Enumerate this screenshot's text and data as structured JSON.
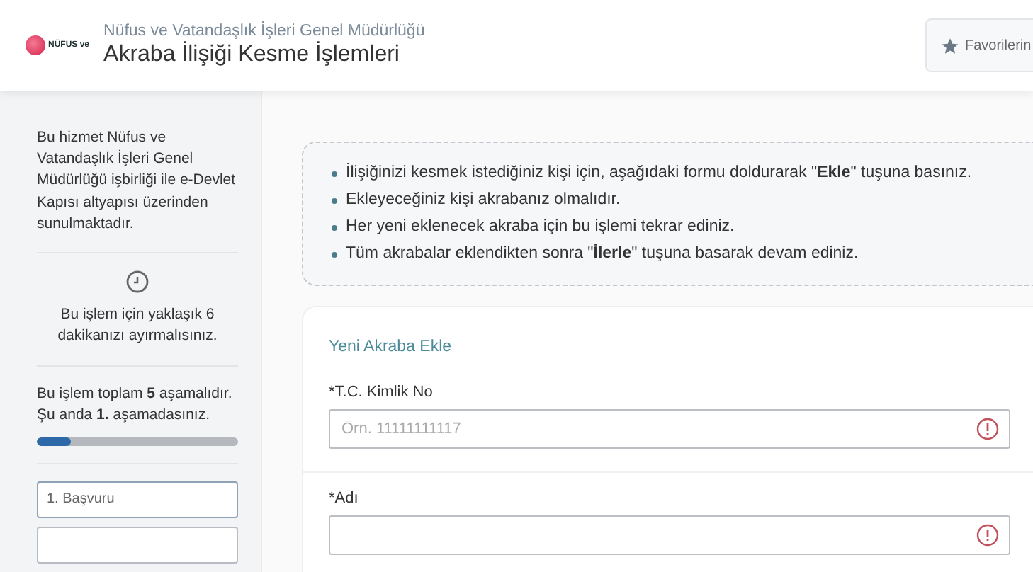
{
  "header": {
    "logo_text": "NÜFUS ve",
    "organization": "Nüfus ve Vatandaşlık İşleri Genel Müdürlüğü",
    "title": "Akraba İlişiği Kesme İşlemleri",
    "favorites_button": "Favorilerin"
  },
  "sidebar": {
    "info": "Bu hizmet Nüfus ve Vatandaşlık İşleri Genel Müdürlüğü işbirliği ile e-Devlet Kapısı altyapısı üzerinden sunulmaktadır.",
    "duration": "Bu işlem için yaklaşık 6 dakikanızı ayırmalısınız.",
    "progress": {
      "text": "Bu işlem toplam **5** aşamalıdır. Şu anda **1.** aşamadasınız.",
      "level": 0.17
    },
    "steps": [
      {
        "label": "1. Başvuru",
        "selected": true
      },
      {
        "selected": false
      }
    ]
  },
  "instructions": [
    "İlişiğinizi kesmek istediğiniz kişi için, aşağıdaki formu doldurarak \"**Ekle**\" tuşuna basınız.",
    "Ekleyeceğiniz kişi akrabanız olmalıdır.",
    "Her yeni eklenecek akraba için bu işlemi tekrar ediniz.",
    "Tüm akrabalar eklendikten sonra \"**İlerle**\" tuşuna basarak devam ediniz."
  ],
  "form": {
    "title": "Yeni Akraba Ekle",
    "fields": [
      {
        "label": "*T.C. Kimlik No",
        "placeholder": "Örn. 11111111117"
      },
      {
        "label": "*Adı"
      }
    ]
  }
}
